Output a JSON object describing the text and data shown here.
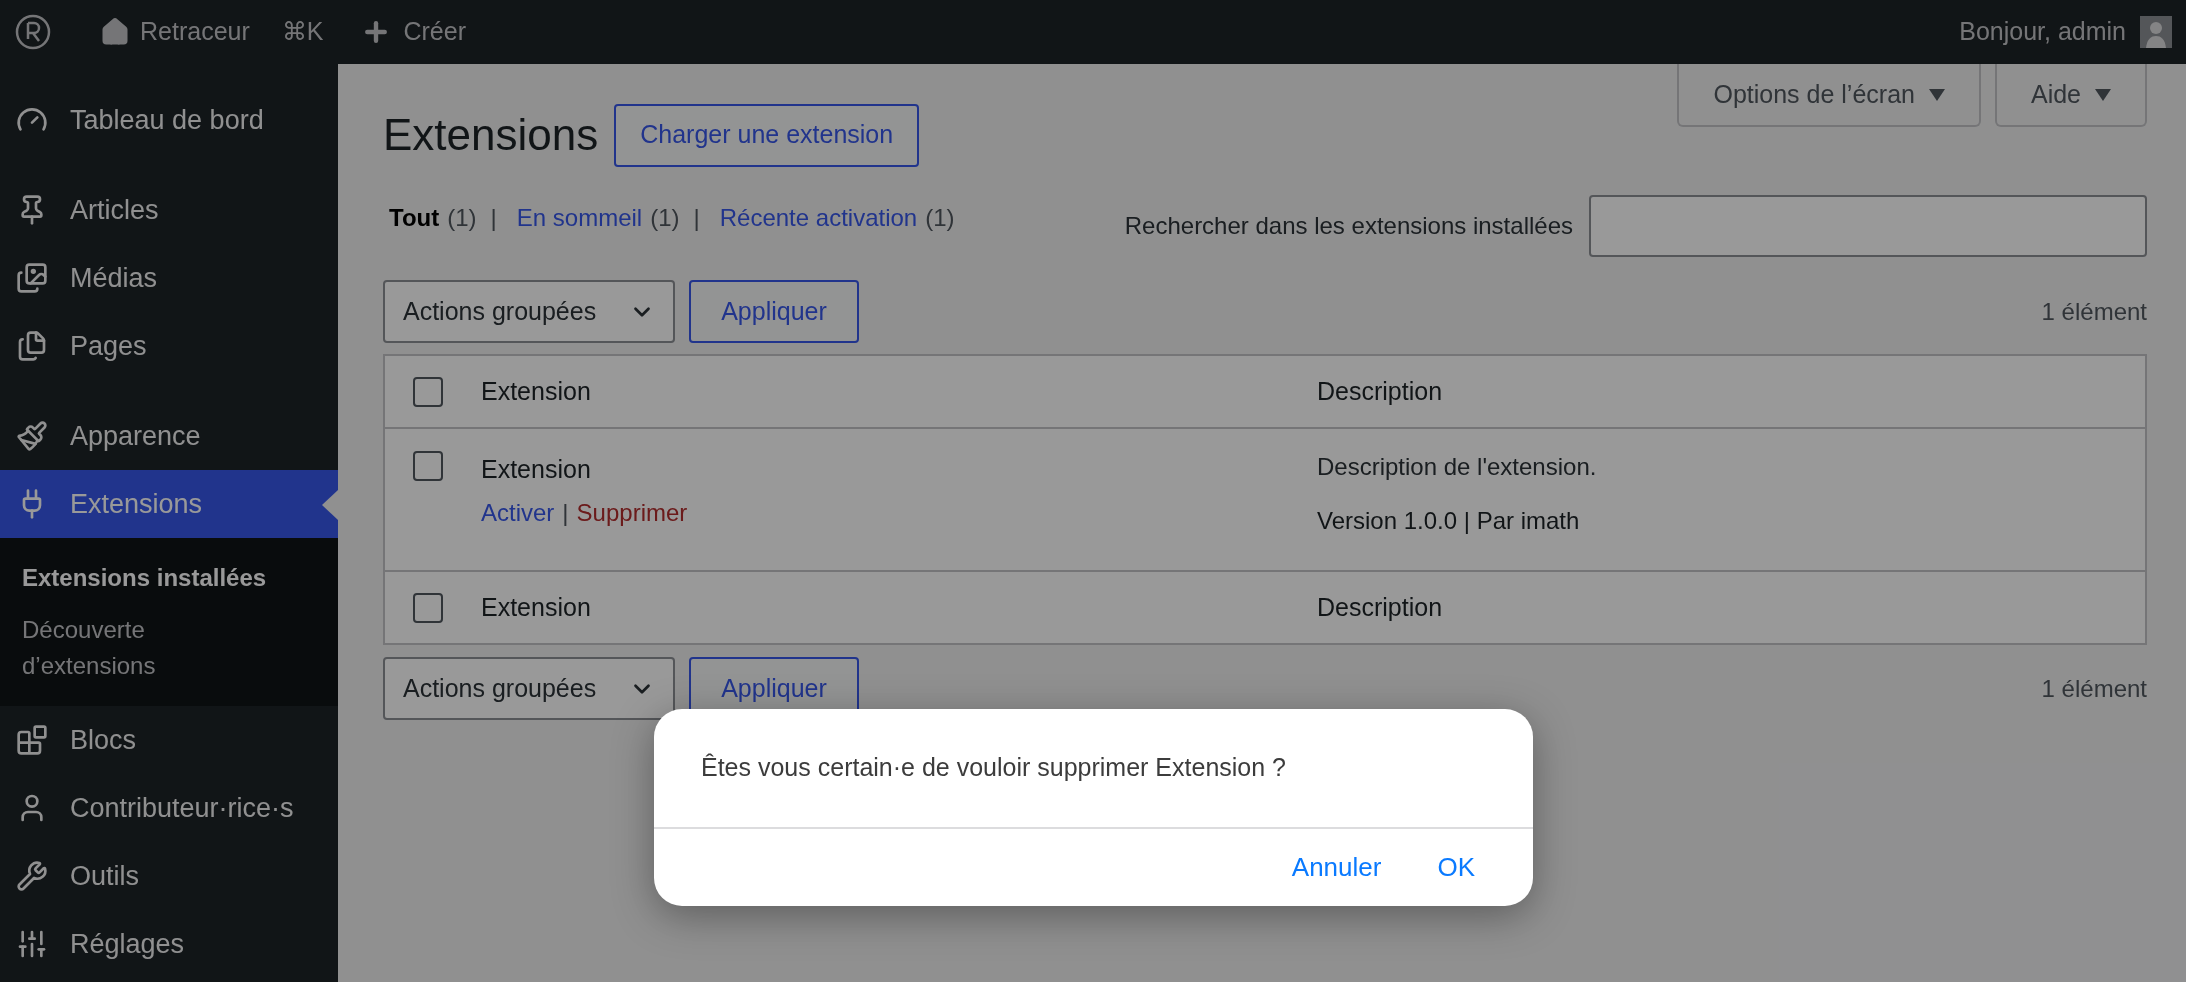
{
  "top_bar": {
    "site": "Retraceur",
    "shortcut": "⌘K",
    "new": "Créer",
    "greeting": "Bonjour, admin"
  },
  "sidebar": {
    "groups": [
      {
        "items": [
          {
            "label": "Tableau de bord",
            "selected": false
          }
        ]
      },
      {
        "items": [
          {
            "label": "Articles",
            "selected": false
          },
          {
            "label": "Médias",
            "selected": false
          },
          {
            "label": "Pages",
            "selected": false
          }
        ]
      },
      {
        "items": [
          {
            "label": "Apparence",
            "selected": false
          },
          {
            "label": "Extensions",
            "selected": true,
            "children": [
              {
                "label": "Extensions installées",
                "selected": true
              },
              {
                "label": "Découverte d’extensions",
                "selected": false
              }
            ]
          },
          {
            "label": "Blocs",
            "selected": false
          },
          {
            "label": "Contributeur·rice·s",
            "selected": false
          },
          {
            "label": "Outils",
            "selected": false
          },
          {
            "label": "Réglages",
            "selected": false
          }
        ]
      }
    ]
  },
  "screen_meta": [
    "Options de l’écran",
    "Aide"
  ],
  "page": {
    "title": "Extensions",
    "add_button": "Charger une extension"
  },
  "filters": {
    "separator": "|",
    "items": [
      {
        "label": "Tout",
        "count": "(1)",
        "selected": true
      },
      {
        "label": "En sommeil",
        "count": "(1)",
        "selected": false
      },
      {
        "label": "Récente activation",
        "count": "(1)",
        "selected": false
      }
    ]
  },
  "search": {
    "label": "Rechercher dans les extensions installées"
  },
  "bulk_top": {
    "select": "Actions groupées",
    "apply": "Appliquer",
    "count": "1 élément"
  },
  "table": {
    "columns": [
      "Extension",
      "Description"
    ],
    "select_all_checked": false,
    "rows": [
      {
        "checked": false,
        "name": "Extension",
        "action_separator": "|",
        "actions": [
          {
            "label": "Activer",
            "kind": "activate"
          },
          {
            "label": "Supprimer",
            "kind": "delete"
          }
        ],
        "description": "Description de l'extension.",
        "meta": "Version 1.0.0 | Par imath"
      }
    ],
    "footer_columns": [
      "Extension",
      "Description"
    ],
    "footer_select_all_checked": false
  },
  "bulk_bottom": {
    "select": "Actions groupées",
    "apply": "Appliquer",
    "count": "1 élément"
  },
  "dialog": {
    "message": "Êtes vous certain·e de vouloir supprimer Extension ?",
    "buttons": [
      "Annuler",
      "OK"
    ]
  }
}
